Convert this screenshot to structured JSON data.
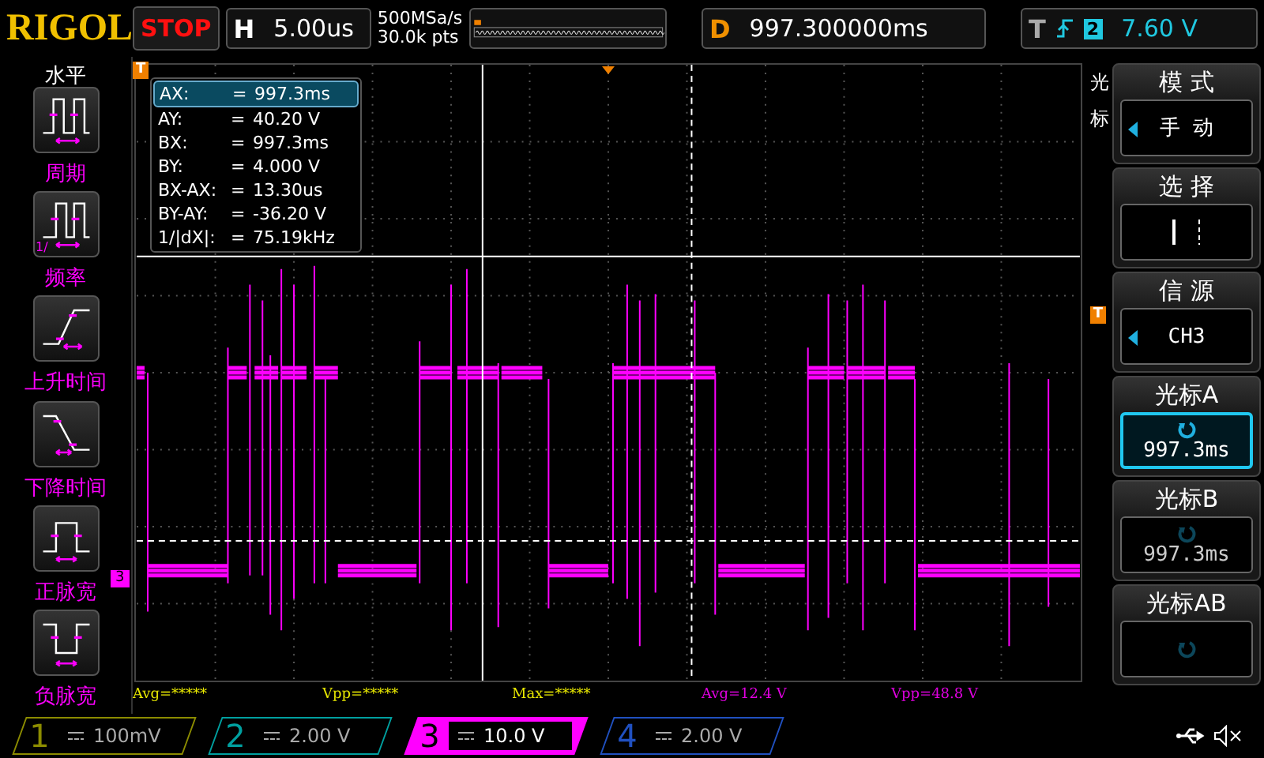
{
  "header": {
    "logo": "RIGOL",
    "run_state": "STOP",
    "timebase_label": "H",
    "timebase": "5.00us",
    "sample_rate": "500MSa/s",
    "memory_depth": "30.0k pts",
    "delay_label": "D",
    "delay": "997.300000ms",
    "trigger_label": "T",
    "trigger_channel": "2",
    "trigger_level": "7.60 V"
  },
  "left_menu": {
    "title": "水平",
    "items": [
      {
        "kind": "period",
        "label": "周期"
      },
      {
        "kind": "frequency",
        "label": "频率",
        "icon_text": "1/"
      },
      {
        "kind": "rise",
        "label": "上升时间"
      },
      {
        "kind": "fall",
        "label": "下降时间"
      },
      {
        "kind": "positive",
        "label": "正脉宽"
      },
      {
        "kind": "negative",
        "label": "负脉宽"
      }
    ]
  },
  "cursor_readout": [
    {
      "name": "AX:",
      "equals": "=",
      "value": "997.3ms",
      "selected": true
    },
    {
      "name": "AY:",
      "equals": "=",
      "value": "40.20 V",
      "selected": false
    },
    {
      "name": "BX:",
      "equals": "=",
      "value": "997.3ms",
      "selected": false
    },
    {
      "name": "BY:",
      "equals": "=",
      "value": "4.000 V",
      "selected": false
    },
    {
      "name": "BX-AX:",
      "equals": "=",
      "value": "13.30us",
      "selected": false
    },
    {
      "name": "BY-AY:",
      "equals": "=",
      "value": "-36.20 V",
      "selected": false
    },
    {
      "name": "1/|dX|:",
      "equals": "=",
      "value": "75.19kHz",
      "selected": false
    }
  ],
  "markers": {
    "trigger_position": "T",
    "trigger_level": "T",
    "channel": "3"
  },
  "measurements": [
    {
      "text": "Avg=*****",
      "color": "#e8e800"
    },
    {
      "text": "Vpp=*****",
      "color": "#e8e800"
    },
    {
      "text": "Max=*****",
      "color": "#e8e800"
    },
    {
      "text": "Avg=12.4 V",
      "color": "#e000e0"
    },
    {
      "text": "Vpp=48.8 V",
      "color": "#e000e0"
    }
  ],
  "right_menu": {
    "title": "光标",
    "items": [
      {
        "kind": "option",
        "label": "模 式",
        "value": "手 动"
      },
      {
        "kind": "select",
        "label": "选 择"
      },
      {
        "kind": "option",
        "label": "信 源",
        "value": "CH3"
      },
      {
        "kind": "knob",
        "label": "光标A",
        "value": "997.3ms",
        "selected": true
      },
      {
        "kind": "knob",
        "label": "光标B",
        "value": "997.3ms",
        "selected": false
      },
      {
        "kind": "knob",
        "label": "光标AB",
        "selected": false
      }
    ]
  },
  "channels": [
    {
      "number": "1",
      "scale": "100mV",
      "color": "#8c8c00",
      "selected": false
    },
    {
      "number": "2",
      "scale": "2.00 V",
      "color": "#00a0a0",
      "selected": false
    },
    {
      "number": "3",
      "scale": "10.0 V",
      "color": "#ff00ff",
      "selected": true
    },
    {
      "number": "4",
      "scale": "2.00 V",
      "color": "#2050c0",
      "selected": false
    }
  ]
}
